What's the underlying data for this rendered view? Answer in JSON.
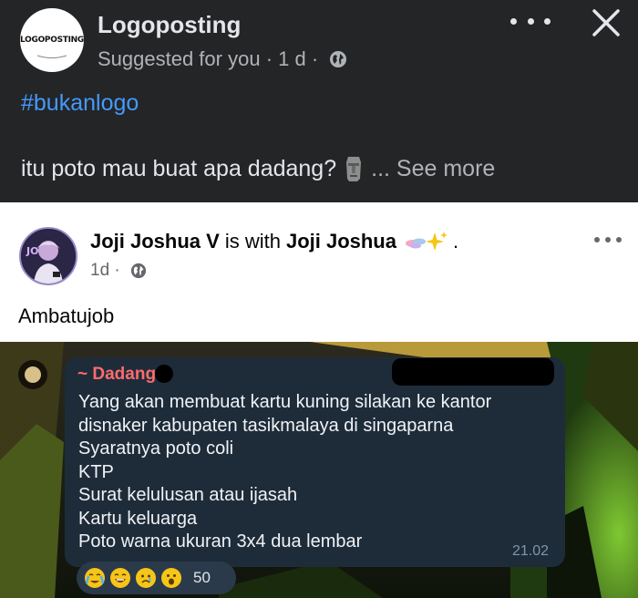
{
  "outer_post": {
    "avatar_text": "LOGOPOSTING",
    "page_name": "Logoposting",
    "meta_suggested": "Suggested for you",
    "meta_sep1": " · ",
    "meta_time": "1 d",
    "meta_sep2": " · ",
    "hashtag": "#bukanlogo",
    "caption": "itu poto mau buat apa dadang?",
    "see_more": "... See more",
    "caption_emoji": "moai-emoji"
  },
  "shared_post": {
    "author": "Joji Joshua V",
    "with_text": "is with",
    "tagged": "Joji Joshua",
    "tagged_suffix": ".",
    "time": "1d",
    "time_sep": " · ",
    "text": "Ambatujob"
  },
  "chat": {
    "sender": "~ Dadang",
    "lines": [
      "Yang akan membuat kartu kuning silakan ke kantor",
      "disnaker kabupaten tasikmalaya di singaparna",
      "Syaratnya poto coli",
      "KTP",
      "Surat kelulusan atau ijasah",
      "Kartu keluarga",
      "Poto warna ukuran 3x4 dua lembar"
    ],
    "time": "21.02",
    "reactions": [
      "crying-face",
      "laughing-face",
      "sad-face",
      "surprised-face"
    ],
    "reaction_count": "50"
  },
  "colors": {
    "dark_bg": "#242526",
    "white_bg": "#ffffff",
    "link_blue": "#4599ff",
    "bubble_bg": "#1e2c3a",
    "sender_red": "#ff6b6b"
  }
}
